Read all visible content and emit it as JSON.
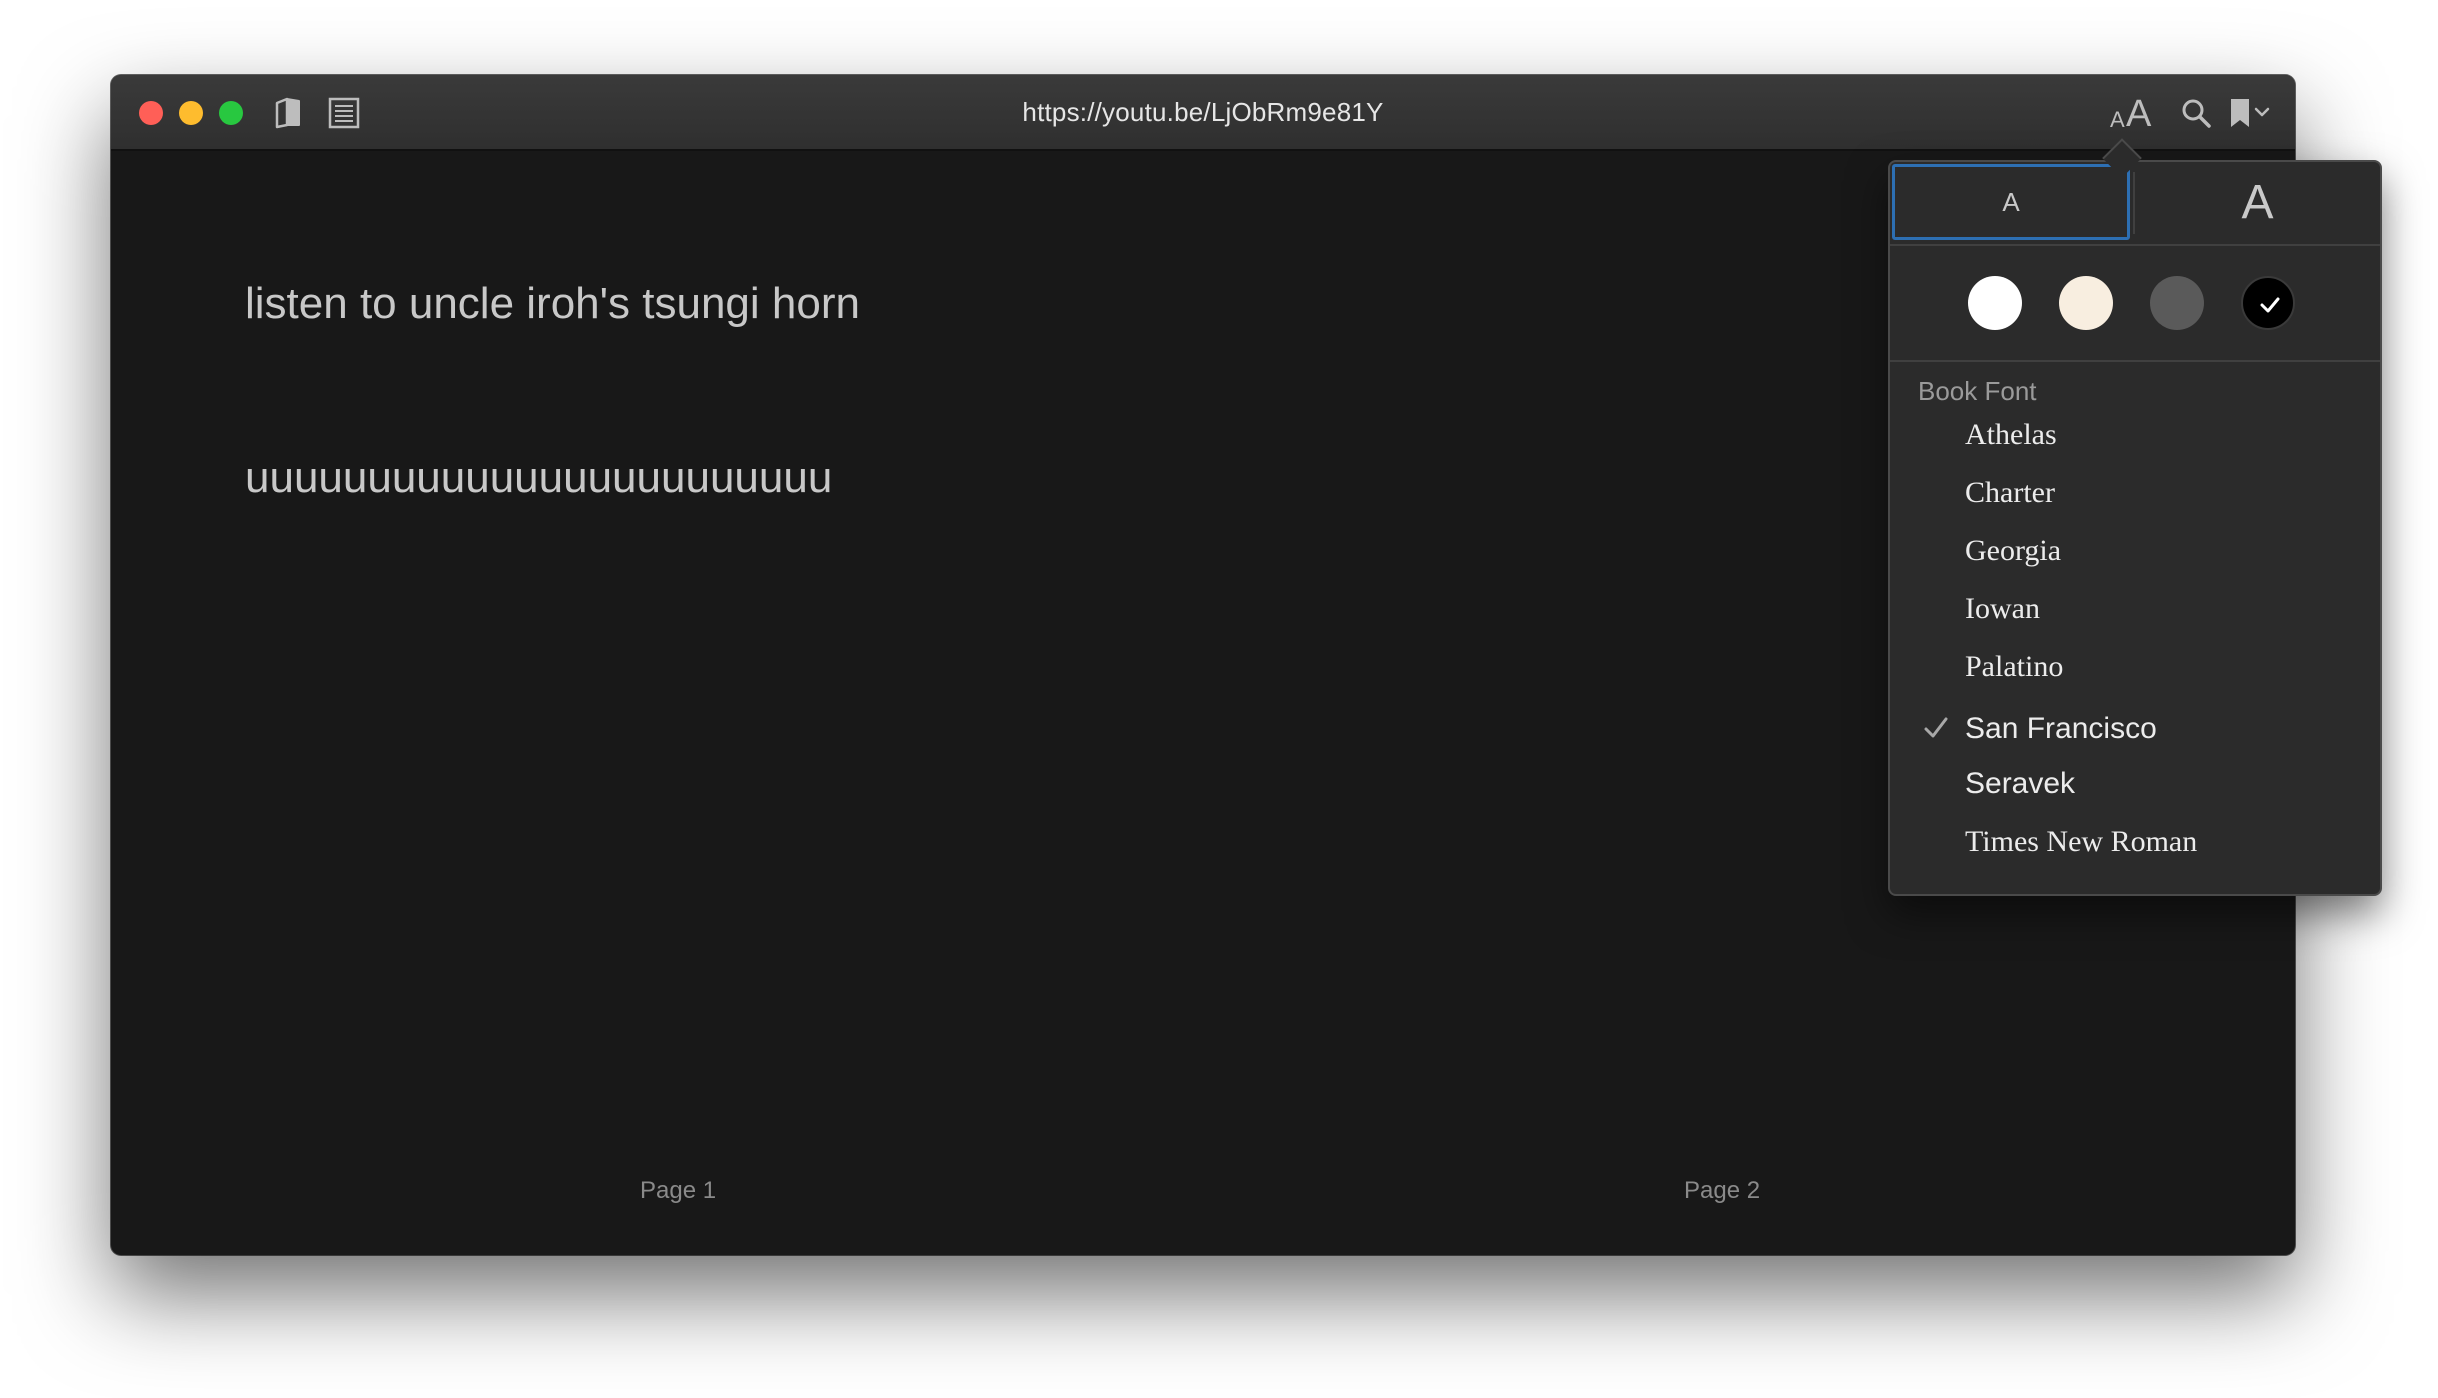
{
  "window": {
    "url": "https://youtu.be/LjObRm9e81Y"
  },
  "toolbar": {
    "font_size_small_glyph": "A",
    "font_size_large_glyph": "A",
    "icons": [
      "book-icon",
      "table-of-contents-icon",
      "font-size-icon",
      "search-icon",
      "bookmark-icon",
      "chevron-down-icon"
    ]
  },
  "content": {
    "line1": "listen to uncle iroh's tsungi horn",
    "line2": "uuuuuuuuuuuuuuuuuuuuuuuu",
    "page1_label": "Page 1",
    "page2_label": "Page 2"
  },
  "popover": {
    "size_small_label": "A",
    "size_large_label": "A",
    "themes": [
      {
        "name": "white",
        "color": "#ffffff"
      },
      {
        "name": "sepia",
        "color": "#f8eee0"
      },
      {
        "name": "gray",
        "color": "#5a5a5a"
      },
      {
        "name": "night",
        "color": "#000000",
        "selected": true
      }
    ],
    "section_label": "Book Font",
    "fonts": [
      {
        "label": "Athelas"
      },
      {
        "label": "Charter"
      },
      {
        "label": "Georgia"
      },
      {
        "label": "Iowan"
      },
      {
        "label": "Palatino"
      },
      {
        "label": "San Francisco",
        "selected": true
      },
      {
        "label": "Seravek"
      },
      {
        "label": "Times New Roman"
      }
    ]
  },
  "colors": {
    "accent": "#2d6fb3",
    "background": "#181818",
    "titlebar": "#333333",
    "close": "#ff5f57",
    "minimize": "#febc2e",
    "maximize": "#28c840"
  }
}
